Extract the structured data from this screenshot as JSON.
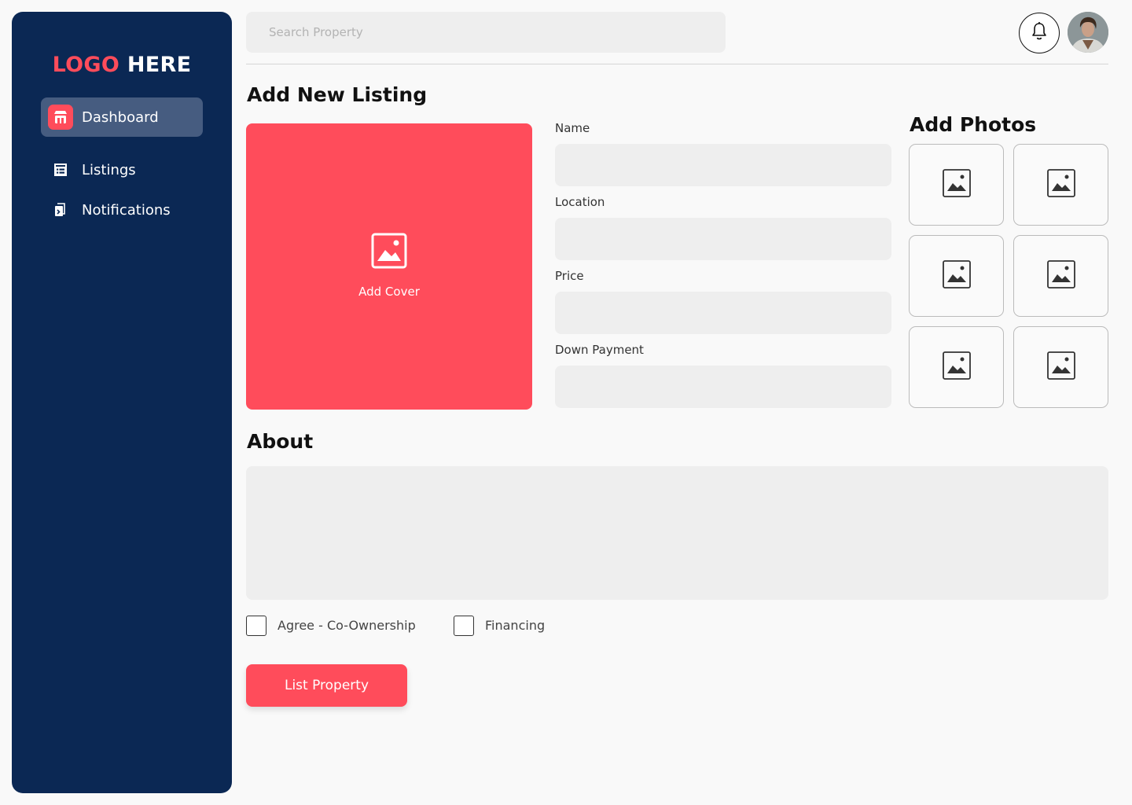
{
  "brand": {
    "logo_part1": "LOGO",
    "logo_part2": "HERE",
    "accent_color": "#ff4c5b",
    "sidebar_color": "#0b2854"
  },
  "sidebar": {
    "items": [
      {
        "label": "Dashboard",
        "icon": "store-icon",
        "active": true
      },
      {
        "label": "Listings",
        "icon": "listings-grid-icon",
        "active": false
      },
      {
        "label": "Notifications",
        "icon": "notification-docs-icon",
        "active": false
      }
    ]
  },
  "header": {
    "search_placeholder": "Search Property",
    "bell_icon": "bell-icon",
    "avatar_icon": "user-avatar"
  },
  "main": {
    "title": "Add New Listing",
    "cover_label": "Add Cover",
    "fields": [
      {
        "label": "Name",
        "value": ""
      },
      {
        "label": "Location",
        "value": ""
      },
      {
        "label": "Price",
        "value": ""
      },
      {
        "label": "Down Payment",
        "value": ""
      }
    ],
    "photos_title": "Add Photos",
    "photo_slot_icon": "image-icon",
    "about_title": "About",
    "about_value": "",
    "checkboxes": [
      {
        "label": "Agree - Co-Ownership",
        "checked": false
      },
      {
        "label": "Financing",
        "checked": false
      }
    ],
    "submit_label": "List Property"
  }
}
